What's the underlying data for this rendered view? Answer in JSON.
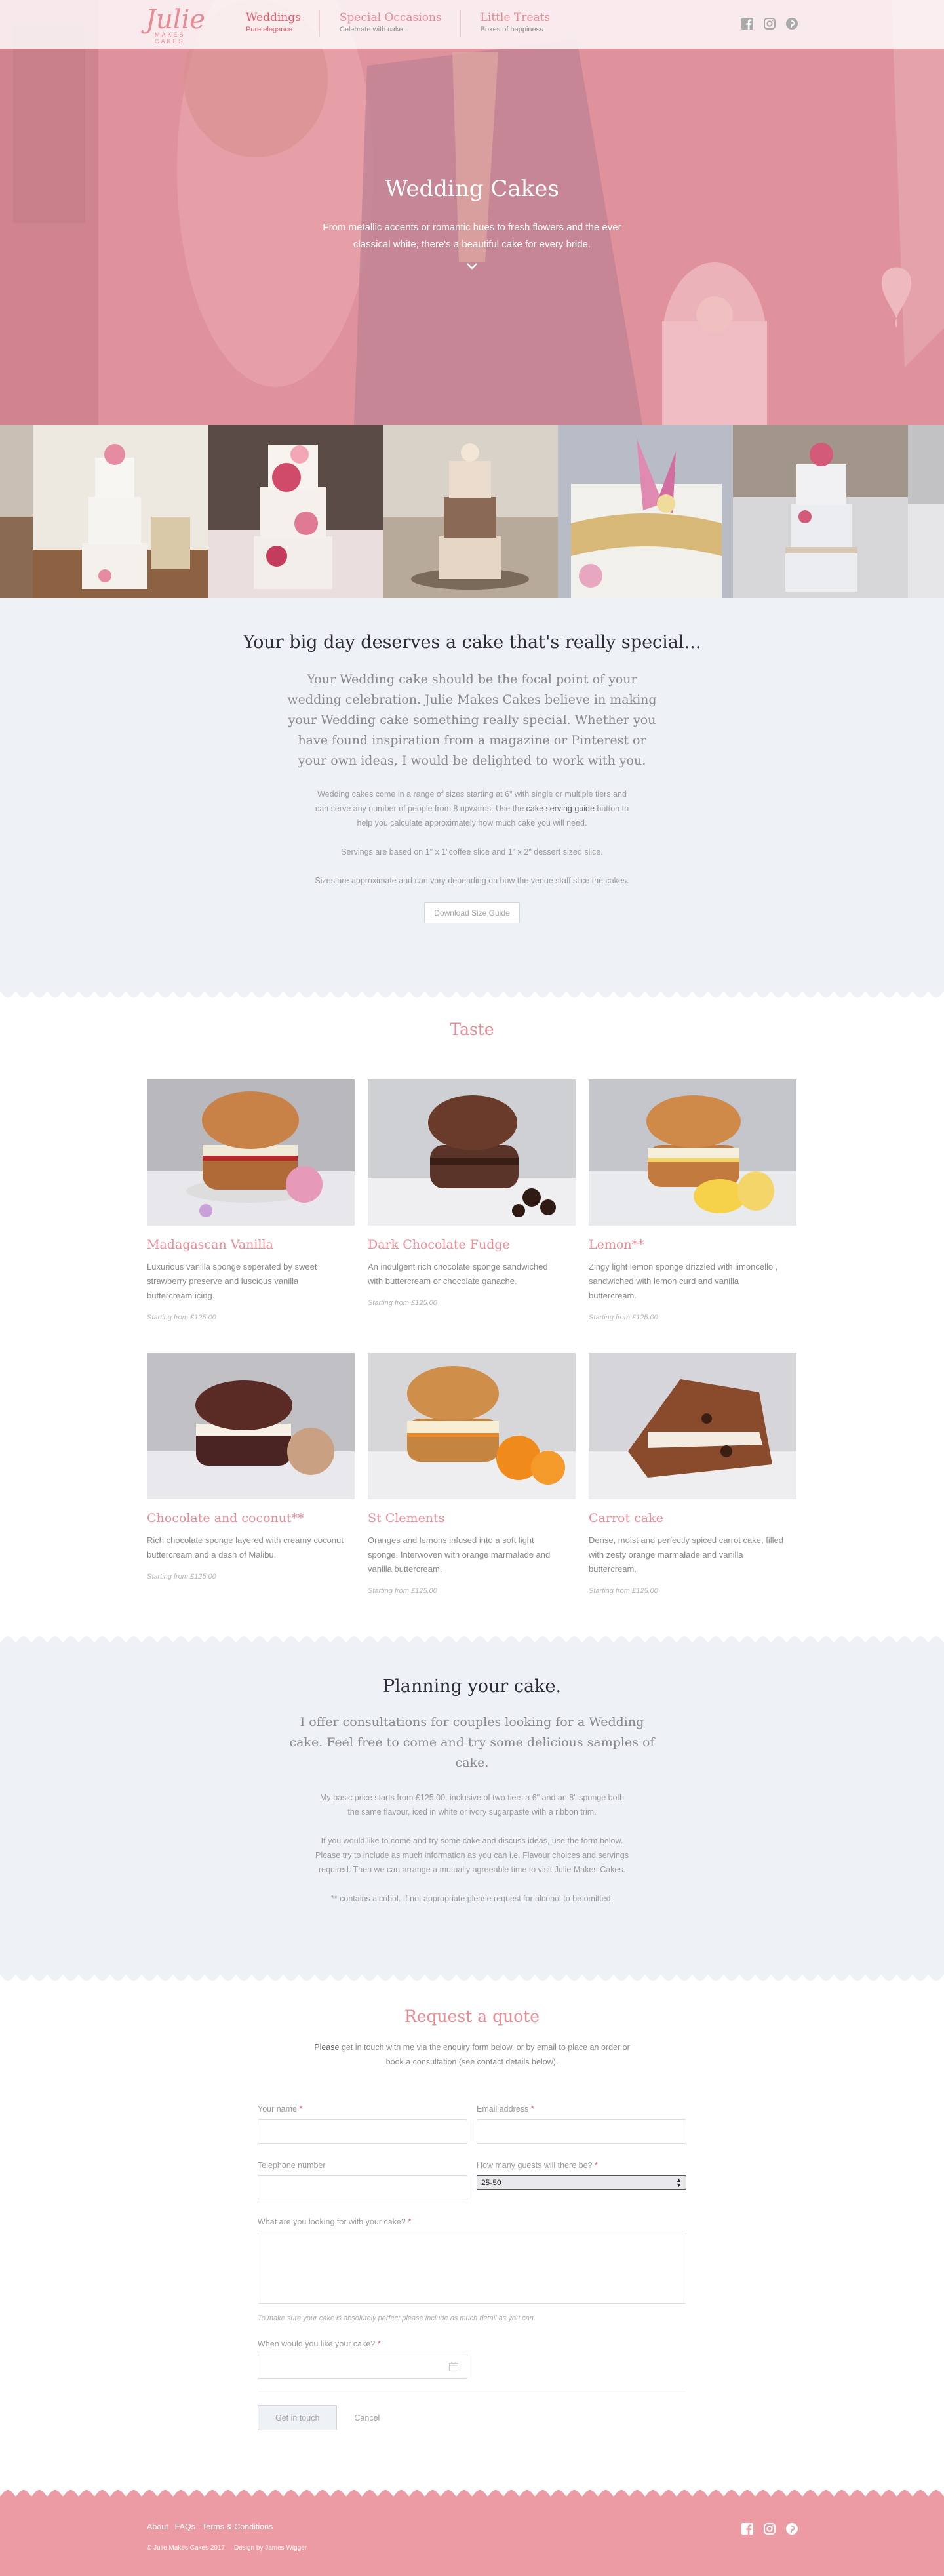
{
  "header": {
    "logo_script": "Julie",
    "logo_sub": "MAKES CAKES",
    "nav": [
      {
        "title": "Weddings",
        "sub": "Pure elegance"
      },
      {
        "title": "Special Occasions",
        "sub": "Celebrate with cake..."
      },
      {
        "title": "Little Treats",
        "sub": "Boxes of happiness"
      }
    ],
    "social": [
      "facebook-icon",
      "instagram-icon",
      "pinterest-icon"
    ]
  },
  "hero": {
    "title": "Wedding Cakes",
    "text": "From metallic accents or romantic hues to fresh flowers and the ever classical white, there's a beautiful cake for every bride."
  },
  "intro": {
    "heading": "Your big day deserves a cake that's really special...",
    "lead": "Your Wedding cake should be the focal point of your wedding celebration. Julie Makes Cakes believe in making your Wedding cake something really special. Whether you have found inspiration from a magazine or Pinterest or your own ideas, I would be delighted to work with you.",
    "p1_a": "Wedding cakes come in a range of sizes starting at 6\" with single or multiple tiers and can serve any number of people from 8 upwards. Use the ",
    "p1_link": "cake serving guide",
    "p1_b": " button to help you calculate approximately how much cake you will need.",
    "p2": "Servings are based on 1\" x 1\"coffee slice and 1\" x 2\" dessert sized slice.",
    "p3": "Sizes are approximate and can vary depending on how the venue staff slice the cakes.",
    "button": "Download Size Guide"
  },
  "taste": {
    "heading": "Taste",
    "cards": [
      {
        "title": "Madagascan Vanilla",
        "desc": "Luxurious vanilla sponge seperated by sweet strawberry preserve and luscious vanilla buttercream icing.",
        "price": "Starting from £125.00"
      },
      {
        "title": "Dark Chocolate Fudge",
        "desc": "An indulgent rich chocolate sponge sandwiched with buttercream or chocolate ganache.",
        "price": "Starting from £125.00"
      },
      {
        "title": "Lemon**",
        "desc": "Zingy light lemon sponge drizzled with limoncello , sandwiched with lemon curd and vanilla buttercream.",
        "price": "Starting from £125.00"
      },
      {
        "title": "Chocolate and coconut**",
        "desc": "Rich chocolate sponge layered with creamy coconut buttercream and a dash of Malibu.",
        "price": "Starting from £125.00"
      },
      {
        "title": "St Clements",
        "desc": "Oranges and lemons infused into a soft light sponge. Interwoven with orange marmalade and vanilla buttercream.",
        "price": "Starting from £125.00"
      },
      {
        "title": "Carrot cake",
        "desc": "Dense, moist and perfectly spiced carrot cake, filled with zesty orange marmalade and vanilla buttercream.",
        "price": "Starting from £125.00"
      }
    ]
  },
  "planning": {
    "heading": "Planning your cake.",
    "lead": "I offer consultations for couples looking for a Wedding cake. Feel free to come and try some delicious samples of cake.",
    "p1": "My basic price starts from £125.00, inclusive of two tiers a 6\" and an 8\" sponge both the same flavour, iced in white or ivory sugarpaste with a ribbon trim.",
    "p2": "If you would like to come and try some cake and discuss ideas, use the form below. Please try to include as much information as you can i.e. Flavour choices and servings required. Then we can arrange a mutually agreeable time to visit Julie Makes Cakes.",
    "p3": "** contains alcohol. If not appropriate please request for alcohol to be omitted."
  },
  "quote": {
    "heading": "Request a quote",
    "intro_a": "Please",
    "intro_b": " get in touch with me via the enquiry form below, or by email to place an order or book a consultation (see contact details below).",
    "name_label": "Your name",
    "email_label": "Email address",
    "phone_label": "Telephone number",
    "guests_label": "How many guests will there be?",
    "guests_value": "25-50",
    "looking_label": "What are you looking for with your cake?",
    "hint": "To make sure your cake is absolutely perfect please include as much detail as you can.",
    "date_label": "When would you like your cake?",
    "submit": "Get in touch",
    "cancel": "Cancel",
    "required_mark": "*"
  },
  "footer": {
    "links": [
      "About",
      "FAQs",
      "Terms & Conditions"
    ],
    "copyright": "© Julie Makes Cakes 2017     Design by James Wigger"
  }
}
